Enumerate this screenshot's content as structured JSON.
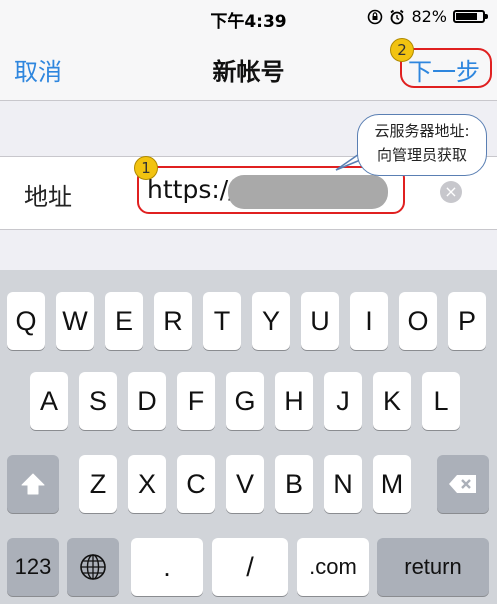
{
  "status": {
    "time": "下午4:39",
    "battery": "82%",
    "battery_level": 0.82
  },
  "nav": {
    "cancel": "取消",
    "title": "新帐号",
    "next": "下一步"
  },
  "annotations": {
    "badge1": "1",
    "badge2": "2",
    "callout_line1": "云服务器地址:",
    "callout_line2": "向管理员获取"
  },
  "field": {
    "label": "地址",
    "value": "https://",
    "clear": "×"
  },
  "keyboard": {
    "row1": [
      "Q",
      "W",
      "E",
      "R",
      "T",
      "Y",
      "U",
      "I",
      "O",
      "P"
    ],
    "row2": [
      "A",
      "S",
      "D",
      "F",
      "G",
      "H",
      "J",
      "K",
      "L"
    ],
    "row3": [
      "Z",
      "X",
      "C",
      "V",
      "B",
      "N",
      "M"
    ],
    "bottom": {
      "numbers": "123",
      "dot": ".",
      "slash": "/",
      "dotcom": ".com",
      "return": "return"
    },
    "shift": "shift-icon",
    "delete": "delete-icon",
    "globe": "globe-icon"
  },
  "colors": {
    "accent": "#2e86de",
    "annotation_red": "#e02020",
    "badge_yellow": "#f2c310"
  }
}
